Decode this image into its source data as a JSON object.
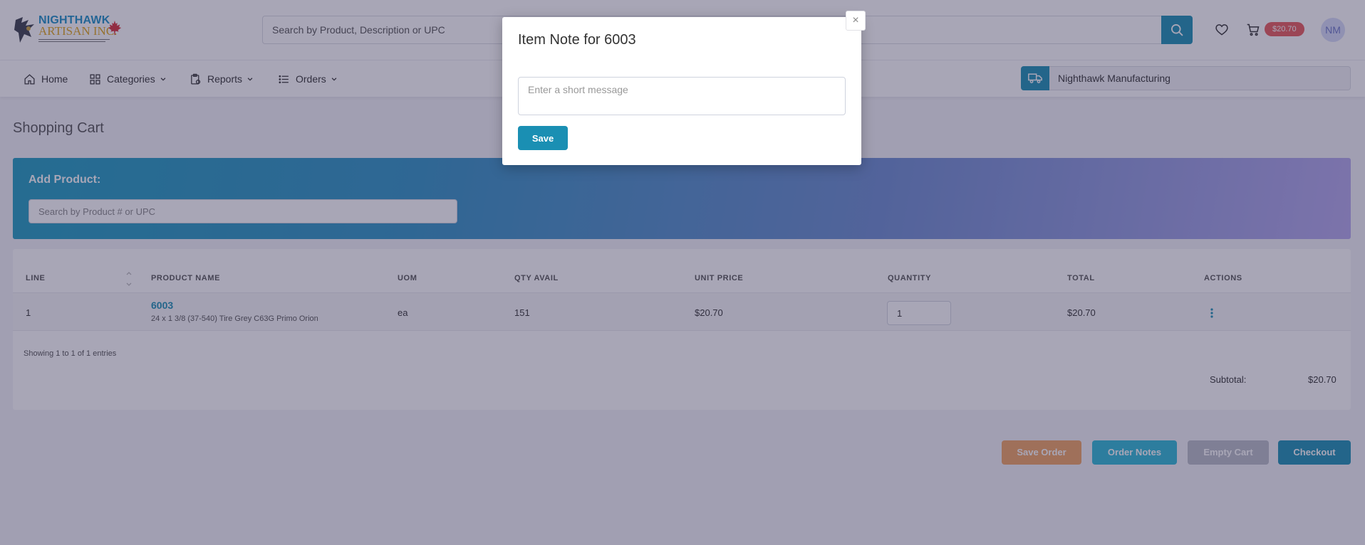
{
  "header": {
    "logo_line1": "NIGHTHAWK",
    "logo_line2": "ARTISAN INC.",
    "search_placeholder": "Search by Product, Description or UPC",
    "cart_total": "$20.70",
    "avatar_initials": "NM"
  },
  "nav": {
    "items": [
      {
        "label": "Home",
        "icon": "home-icon"
      },
      {
        "label": "Categories",
        "icon": "grid-icon"
      },
      {
        "label": "Reports",
        "icon": "report-icon"
      },
      {
        "label": "Orders",
        "icon": "list-icon"
      }
    ],
    "vendor": "Nighthawk Manufacturing"
  },
  "page": {
    "title": "Shopping Cart",
    "add_product_label": "Add Product:",
    "add_product_placeholder": "Search by Product # or UPC"
  },
  "table": {
    "columns": [
      "LINE",
      "PRODUCT NAME",
      "UOM",
      "QTY AVAIL",
      "UNIT PRICE",
      "QUANTITY",
      "TOTAL",
      "ACTIONS"
    ],
    "rows": [
      {
        "line": "1",
        "product": "6003",
        "description": "24 x 1 3/8 (37-540) Tire Grey C63G Primo Orion",
        "uom": "ea",
        "qty_avail": "151",
        "unit_price": "$20.70",
        "quantity": "1",
        "total": "$20.70"
      }
    ],
    "showing": "Showing 1 to 1 of 1 entries",
    "subtotal_label": "Subtotal:",
    "subtotal_value": "$20.70"
  },
  "actions": {
    "save_order": "Save Order",
    "order_notes": "Order Notes",
    "empty_cart": "Empty Cart",
    "checkout": "Checkout"
  },
  "modal": {
    "title": "Item Note for 6003",
    "close": "×",
    "placeholder": "Enter a short message",
    "save": "Save"
  },
  "colors": {
    "primary": "#1a8fb3",
    "save_order": "#f0a261",
    "order_notes": "#2bb8d6",
    "empty_cart": "#b8bcc6",
    "badge": "#e85a5a"
  }
}
